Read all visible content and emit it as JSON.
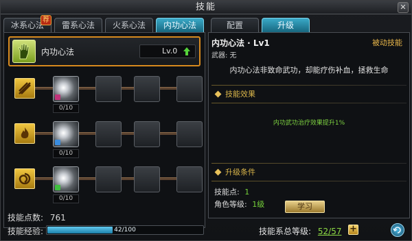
{
  "window": {
    "title": "技能"
  },
  "tabs": {
    "items": [
      {
        "label": "冰系心法",
        "active": false,
        "badge": "荐"
      },
      {
        "label": "雷系心法",
        "active": false
      },
      {
        "label": "火系心法",
        "active": false
      },
      {
        "label": "内功心法",
        "active": true
      }
    ]
  },
  "selected_skill": {
    "name": "内功心法",
    "level": "Lv.0"
  },
  "tree": {
    "rows": [
      {
        "icon": "slash-skill-icon",
        "nodes": [
          {
            "learned": true,
            "count": "0/10"
          },
          {
            "learned": false
          },
          {
            "learned": false
          },
          {
            "learned": false
          }
        ]
      },
      {
        "icon": "flame-skill-icon",
        "nodes": [
          {
            "learned": true,
            "count": "0/10"
          },
          {
            "learned": false
          },
          {
            "learned": false
          },
          {
            "learned": false
          }
        ]
      },
      {
        "icon": "swirl-skill-icon",
        "nodes": [
          {
            "learned": true,
            "count": "0/10"
          },
          {
            "learned": false
          },
          {
            "learned": false
          },
          {
            "learned": false
          }
        ]
      }
    ]
  },
  "stats": {
    "points_label": "技能点数:",
    "points_value": "761",
    "exp_label": "技能经验:",
    "exp_text": "42/100",
    "exp_fraction": 0.42
  },
  "right_tabs": {
    "items": [
      {
        "label": "配置",
        "active": false
      },
      {
        "label": "升级",
        "active": true
      }
    ]
  },
  "detail": {
    "title": "内功心法 · Lv1",
    "passive": "被动技能",
    "weapon": "武器: 无",
    "description": "内功心法非致命武功，却能疗伤补血，拯救生命",
    "effect_header": "技能效果",
    "effect_text": "内功武功治疗效果提升1%",
    "cond_header": "升级条件",
    "cond_points_label": "技能点:",
    "cond_points_value": "1",
    "cond_level_label": "角色等级:",
    "cond_level_value": "1级",
    "learn_button": "学习"
  },
  "footer": {
    "total_label": "技能系总等级:",
    "total_value": "52/57"
  },
  "colors": {
    "accent": "#d88a1e",
    "active_tab": "#2f94b4",
    "green_text": "#77d43a",
    "gold": "#e8c15a"
  }
}
